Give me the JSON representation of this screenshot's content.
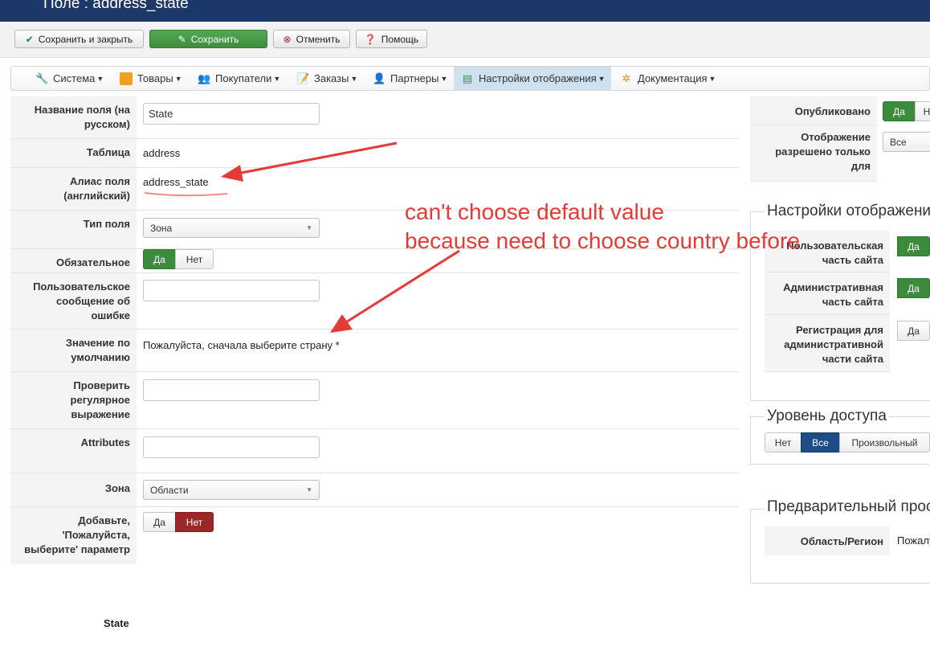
{
  "window": {
    "title": "Поле : address_state"
  },
  "toolbar": {
    "save_close": "Сохранить и закрыть",
    "save": "Сохранить",
    "cancel": "Отменить",
    "help": "Помощь"
  },
  "menu": {
    "items": [
      {
        "label": "Система",
        "icon": "wrench-icon"
      },
      {
        "label": "Товары",
        "icon": "box-icon"
      },
      {
        "label": "Покупатели",
        "icon": "users-icon"
      },
      {
        "label": "Заказы",
        "icon": "orders-icon"
      },
      {
        "label": "Партнеры",
        "icon": "partners-icon"
      },
      {
        "label": "Настройки отображения",
        "icon": "display-settings-icon"
      },
      {
        "label": "Документация",
        "icon": "documentation-icon"
      }
    ]
  },
  "form": {
    "name_label": "Название поля (на русском)",
    "name_value": "State",
    "table_label": "Таблица",
    "table_value": "address",
    "alias_label": "Алиас поля (английский)",
    "alias_value": "address_state",
    "type_label": "Тип поля",
    "type_value": "Зона",
    "required_label": "Обязательное",
    "yes": "Да",
    "no": "Нет",
    "error_msg_label": "Пользовательское сообщение об ошибке",
    "default_label": "Значение по умолчанию",
    "default_value": "Пожалуйста, сначала выберите страну *",
    "regex_label": "Проверить регулярное выражение",
    "attributes_label": "Attributes",
    "zone_label": "Зона",
    "zone_value": "Области",
    "add_please_label": "Добавьте, 'Пожалуйста, выберите' параметр",
    "preview_label": "State"
  },
  "right": {
    "published_label": "Опубликовано",
    "published_yes": "Да",
    "published_no": "Н",
    "display_only_label": "Отображение разрешено только для",
    "display_only_value": "Все",
    "display_settings_legend": "Настройки отображения",
    "public_part_label": "Пользовательская часть сайта",
    "public_yes": "Да",
    "admin_part_label": "Административная часть сайта",
    "admin_yes": "Да",
    "admin_reg_label": "Регистрация для административной части сайта",
    "admin_reg_yes": "Да",
    "access_legend": "Уровень доступа",
    "access_no": "Нет",
    "access_all": "Все",
    "access_custom": "Произвольный",
    "preview_legend": "Предварительный просмотр",
    "region_label": "Область/Регион",
    "region_value": "Пожалуйста, сначала выберите страну"
  },
  "annotation": {
    "line1": "can't choose default value",
    "line2": "because need to choose country before",
    "color": "#e53a35"
  }
}
